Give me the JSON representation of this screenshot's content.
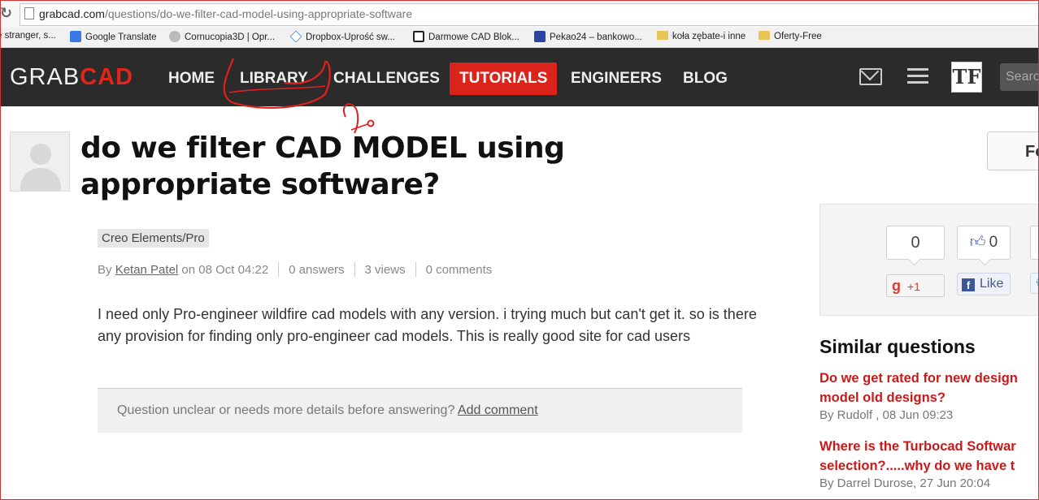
{
  "browser": {
    "url_host": "grabcad.com",
    "url_path": "/questions/do-we-filter-cad-model-using-appropriate-software",
    "bookmarks": [
      {
        "label": "e stranger, s...",
        "icon": "none"
      },
      {
        "label": "Google Translate",
        "icon": "translate-icon"
      },
      {
        "label": "Cornucopia3D | Opr...",
        "icon": "cornucopia-icon"
      },
      {
        "label": "Dropbox-Uprość sw...",
        "icon": "dropbox-icon"
      },
      {
        "label": "Darmowe CAD Blok...",
        "icon": "cad-block-icon"
      },
      {
        "label": "Pekao24 – bankowo...",
        "icon": "pekao-icon"
      },
      {
        "label": "koła zębate-i inne",
        "icon": "folder-icon"
      },
      {
        "label": "Oferty-Free",
        "icon": "folder-icon"
      }
    ]
  },
  "nav": {
    "logo_grab": "GRAB",
    "logo_cad": "CAD",
    "items": [
      "HOME",
      "LIBRARY",
      "CHALLENGES",
      "TUTORIALS",
      "ENGINEERS",
      "BLOG"
    ],
    "active": "TUTORIALS",
    "avatar_text": "TF",
    "search_placeholder": "Searc",
    "accent": "#d9231b"
  },
  "question": {
    "title": "do we filter CAD MODEL using appropriate software?",
    "tag": "Creo Elements/Pro",
    "by": "By",
    "author": "Ketan Patel",
    "date": "on 08 Oct 04:22",
    "answers": "0 answers",
    "views": "3 views",
    "comments": "0 comments",
    "body": "I need only Pro-engineer wildfire cad models with any version. i trying much but can't get it. so is there any provision for finding only pro-engineer cad models. This is really good site for cad users",
    "comment_prompt": "Question unclear or needs more details before answering?",
    "add_comment": "Add comment"
  },
  "sidebar": {
    "follow_label": "Fo",
    "gplus_count": "0",
    "gplus_label": "+1",
    "like_count": "0",
    "like_label": "Like",
    "similar_title": "Similar questions",
    "similar": [
      {
        "line1": "Do we get rated for new design",
        "line2": "model old designs?",
        "by": "By Rudolf , 08 Jun 09:23"
      },
      {
        "line1": "Where is the Turbocad Softwar",
        "line2": "selection?.....why do we have t",
        "by": "By Darrel Durose, 27 Jun 20:04"
      }
    ]
  }
}
